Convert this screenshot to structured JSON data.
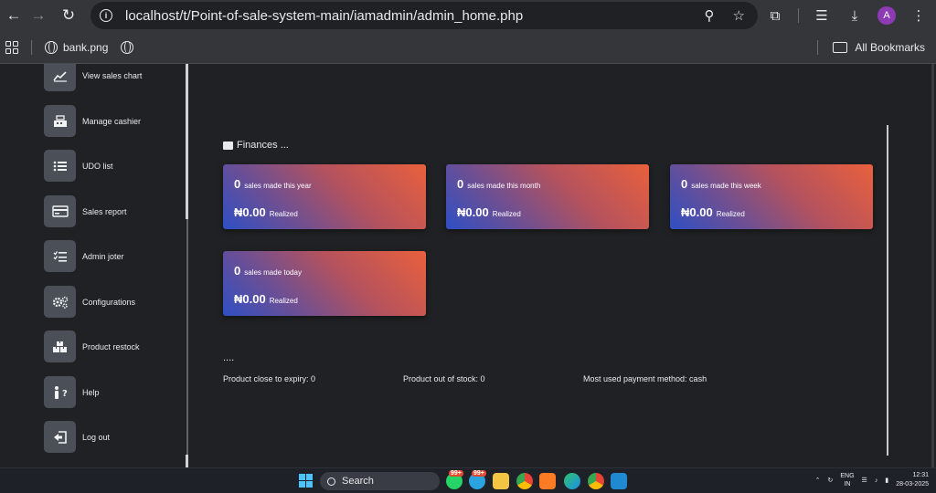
{
  "browser": {
    "url": "localhost/t/Point-of-sale-system-main/iamadmin/admin_home.php",
    "avatar_letter": "A",
    "bookmarks": [
      {
        "label": "bank.png"
      }
    ],
    "all_bookmarks": "All Bookmarks"
  },
  "sidebar": {
    "items": [
      {
        "label": "View sales chart",
        "icon": "chart-icon"
      },
      {
        "label": "Manage cashier",
        "icon": "cash-register-icon"
      },
      {
        "label": "UDO list",
        "icon": "list-icon"
      },
      {
        "label": "Sales report",
        "icon": "report-icon"
      },
      {
        "label": "Admin joter",
        "icon": "checklist-icon"
      },
      {
        "label": "Configurations",
        "icon": "gears-icon"
      },
      {
        "label": "Product restock",
        "icon": "boxes-icon"
      },
      {
        "label": "Help",
        "icon": "help-icon"
      },
      {
        "label": "Log out",
        "icon": "logout-icon"
      }
    ]
  },
  "main": {
    "section_title": "Finances ...",
    "cards": [
      {
        "count": "0",
        "description": "sales made this year",
        "amount": "₦0.00",
        "status": "Realized"
      },
      {
        "count": "0",
        "description": "sales made this month",
        "amount": "₦0.00",
        "status": "Realized"
      },
      {
        "count": "0",
        "description": "sales made this week",
        "amount": "₦0.00",
        "status": "Realized"
      },
      {
        "count": "0",
        "description": "sales made today",
        "amount": "₦0.00",
        "status": "Realized"
      }
    ],
    "dots": "....",
    "stats": {
      "expiry": "Product close to expiry: 0",
      "out_of_stock": "Product out of stock: 0",
      "payment": "Most used payment method: cash"
    }
  },
  "taskbar": {
    "search_label": "Search",
    "badge_1": "99+",
    "badge_2": "99+",
    "lang_1": "ENG",
    "lang_2": "IN",
    "time": "12:31",
    "date": "28-03-2025"
  }
}
